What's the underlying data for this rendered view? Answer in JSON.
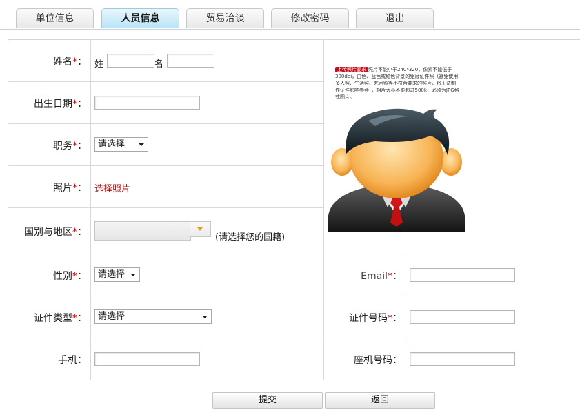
{
  "tabs": [
    {
      "label": "单位信息",
      "active": false
    },
    {
      "label": "人员信息",
      "active": true
    },
    {
      "label": "贸易洽谈",
      "active": false
    },
    {
      "label": "修改密码",
      "active": false
    },
    {
      "label": "退出",
      "active": false
    }
  ],
  "form": {
    "name_label": "姓名",
    "surname_prefix": "姓",
    "given_prefix": "名",
    "birthdate_label": "出生日期",
    "position_label": "职务",
    "position_select": "请选择",
    "photo_label": "照片",
    "photo_link": "选择照片",
    "country_label": "国别与地区",
    "country_hint": "(请选择您的国籍)",
    "gender_label": "性别",
    "gender_select": "请选择",
    "email_label": "Email",
    "idtype_label": "证件类型",
    "idtype_select": "请选择",
    "idnumber_label": "证件号码",
    "mobile_label": "手机",
    "landline_label": "座机号码",
    "required_mark": "*",
    "colon": "："
  },
  "photo_panel": {
    "tag": "上传照片要求",
    "requirements": "照片不能小于240*320，像素不能低于300dpi，白色、蓝色或红色背景的免冠证件照（避免使用多人照、生活照、艺术照等不符合要求的照片，将无法制作证件影响参会），相片大小不能超过500k，必须为JPG格式图片。",
    "avatar": "person-avatar-icon"
  },
  "buttons": {
    "submit": "提交",
    "back": "返回"
  },
  "colors": {
    "required": "#cc0000",
    "photo_link": "#b01010",
    "active_tab": "#b9e3f7",
    "tie": "#d01818"
  }
}
